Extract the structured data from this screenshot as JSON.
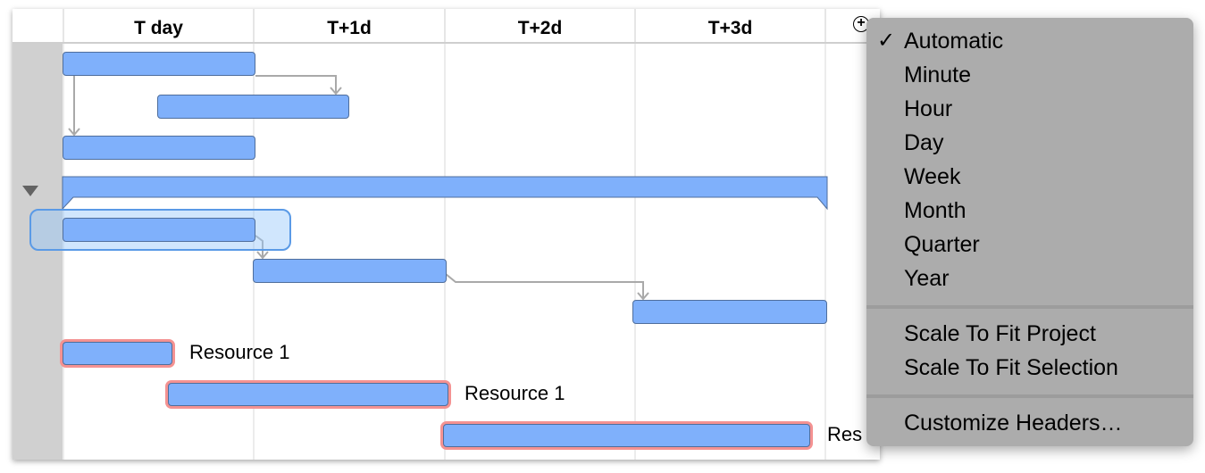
{
  "timeline": {
    "columns": [
      "T day",
      "T+1d",
      "T+2d",
      "T+3d"
    ],
    "add_column_icon": "plus-circle-icon"
  },
  "rows": {
    "group_toggle_icon": "disclosure-triangle-down-icon",
    "resource_labels": [
      "Resource 1",
      "Resource 1",
      "Res"
    ]
  },
  "colors": {
    "bar_fill": "#7fb0fb",
    "bar_border": "#4f6e9c",
    "resource_outline": "#f49292",
    "selection": "#5a9ae6",
    "menu_bg": "#acacac"
  },
  "scale_menu": {
    "check_mark": "✓",
    "selected": "Automatic",
    "units": [
      "Automatic",
      "Minute",
      "Hour",
      "Day",
      "Week",
      "Month",
      "Quarter",
      "Year"
    ],
    "fit_actions": [
      "Scale To Fit Project",
      "Scale To Fit Selection"
    ],
    "customize": "Customize Headers…"
  }
}
